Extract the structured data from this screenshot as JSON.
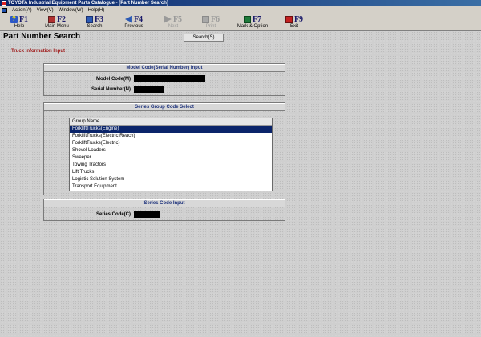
{
  "window": {
    "title": "TOYOTA Industrial Equipment Parts Catalogue - [Part Number Search]"
  },
  "menu": {
    "items": [
      "Action(A)",
      "View(V)",
      "Window(W)",
      "Help(H)"
    ]
  },
  "toolbar": {
    "buttons": [
      {
        "key": "F1",
        "label": "Help",
        "icon": "help-icon",
        "enabled": true
      },
      {
        "key": "F2",
        "label": "Main Menu",
        "icon": "main-menu-icon",
        "enabled": true
      },
      {
        "key": "F3",
        "label": "Search",
        "icon": "search-icon",
        "enabled": true
      },
      {
        "key": "F4",
        "label": "Previous",
        "icon": "previous-icon",
        "enabled": true
      },
      {
        "key": "F5",
        "label": "Next",
        "icon": "next-icon",
        "enabled": false
      },
      {
        "key": "F6",
        "label": "Print",
        "icon": "print-icon",
        "enabled": false
      },
      {
        "key": "F7",
        "label": "Mark & Option",
        "icon": "mark-option-icon",
        "enabled": true
      },
      {
        "key": "F9",
        "label": "Exit",
        "icon": "exit-icon",
        "enabled": true
      }
    ]
  },
  "page": {
    "title": "Part Number Search",
    "search_button": "Search(S)",
    "section_label": "Truck Information Input"
  },
  "model_input": {
    "header": "Model Code(Serial Number) Input",
    "model_code_label": "Model Code(M)",
    "serial_number_label": "Serial Number(N)",
    "model_code_value": "",
    "serial_number_value": ""
  },
  "series_group": {
    "header": "Series Group Code Select",
    "column_header": "Group Name",
    "items": [
      "ForkliftTrucks(Engine)",
      "ForkliftTrucks(Electric Reach)",
      "ForkliftTrucks(Electric)",
      "Shovel Loaders",
      "Sweeper",
      "Towing Tractors",
      "Lift Trucks",
      "Logistic Solution System",
      "Transport Equipment"
    ],
    "selected_index": 0
  },
  "series_code": {
    "header": "Series Code Input",
    "label": "Series Code(C)",
    "value": ""
  },
  "colors": {
    "title_bar": "#0a246a",
    "selection": "#0a246a",
    "section_label": "#a01818",
    "group_header_text": "#1a2f7a"
  }
}
